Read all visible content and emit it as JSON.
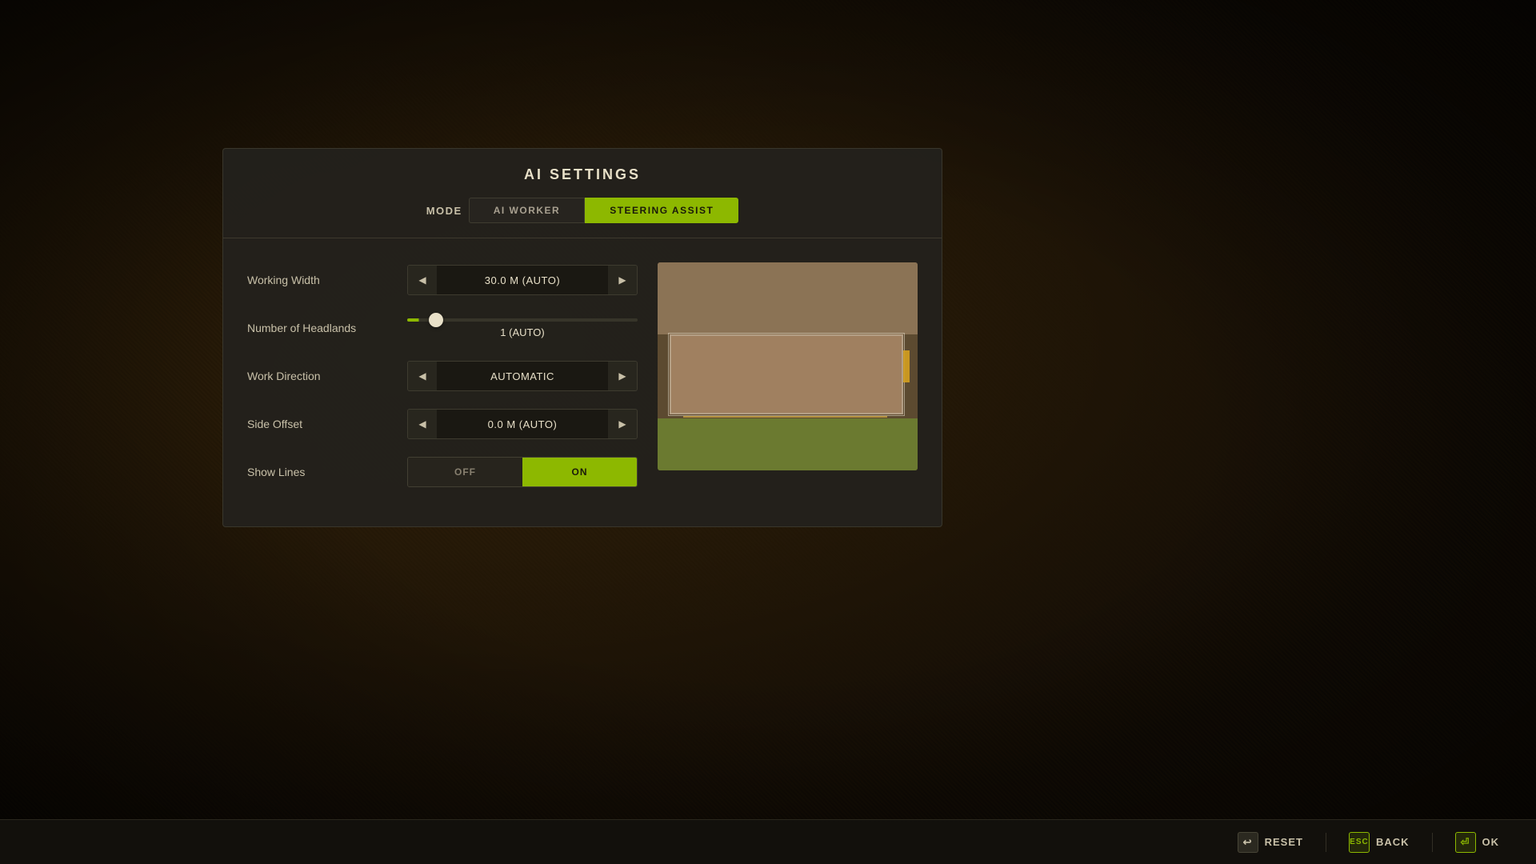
{
  "background": {
    "color": "#1a1208"
  },
  "dialog": {
    "title": "AI SETTINGS",
    "tabs": [
      {
        "id": "mode",
        "label": "MODE",
        "active": false
      },
      {
        "id": "ai-worker",
        "label": "AI WORKER",
        "active": false
      },
      {
        "id": "steering-assist",
        "label": "STEERING ASSIST",
        "active": true
      }
    ],
    "settings": {
      "working_width": {
        "label": "Working Width",
        "value": "30.0 M (AUTO)"
      },
      "number_of_headlands": {
        "label": "Number of Headlands",
        "value": "1 (AUTO)"
      },
      "work_direction": {
        "label": "Work Direction",
        "value": "AUTOMATIC"
      },
      "side_offset": {
        "label": "Side Offset",
        "value": "0.0 M (AUTO)"
      },
      "show_lines": {
        "label": "Show Lines",
        "off_label": "OFF",
        "on_label": "ON",
        "active": "on"
      }
    }
  },
  "bottom_bar": {
    "reset_label": "RESET",
    "back_label": "BACK",
    "ok_label": "OK",
    "esc_label": "ESC"
  }
}
